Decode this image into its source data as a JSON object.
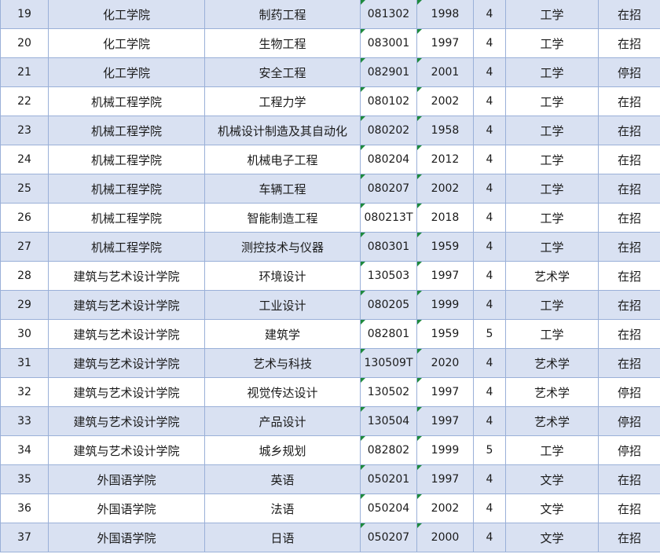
{
  "colors": {
    "band": "#d9e1f2",
    "white": "#ffffff",
    "grid": "#9ab0d8",
    "marker": "#1e8a3e"
  },
  "rows": [
    {
      "no": "19",
      "college": "化工学院",
      "major": "制药工程",
      "code": "081302",
      "year": "1998",
      "duration": "4",
      "degree": "工学",
      "status": "在招"
    },
    {
      "no": "20",
      "college": "化工学院",
      "major": "生物工程",
      "code": "083001",
      "year": "1997",
      "duration": "4",
      "degree": "工学",
      "status": "在招"
    },
    {
      "no": "21",
      "college": "化工学院",
      "major": "安全工程",
      "code": "082901",
      "year": "2001",
      "duration": "4",
      "degree": "工学",
      "status": "停招"
    },
    {
      "no": "22",
      "college": "机械工程学院",
      "major": "工程力学",
      "code": "080102",
      "year": "2002",
      "duration": "4",
      "degree": "工学",
      "status": "在招"
    },
    {
      "no": "23",
      "college": "机械工程学院",
      "major": "机械设计制造及其自动化",
      "code": "080202",
      "year": "1958",
      "duration": "4",
      "degree": "工学",
      "status": "在招"
    },
    {
      "no": "24",
      "college": "机械工程学院",
      "major": "机械电子工程",
      "code": "080204",
      "year": "2012",
      "duration": "4",
      "degree": "工学",
      "status": "在招"
    },
    {
      "no": "25",
      "college": "机械工程学院",
      "major": "车辆工程",
      "code": "080207",
      "year": "2002",
      "duration": "4",
      "degree": "工学",
      "status": "在招"
    },
    {
      "no": "26",
      "college": "机械工程学院",
      "major": "智能制造工程",
      "code": "080213T",
      "year": "2018",
      "duration": "4",
      "degree": "工学",
      "status": "在招"
    },
    {
      "no": "27",
      "college": "机械工程学院",
      "major": "测控技术与仪器",
      "code": "080301",
      "year": "1959",
      "duration": "4",
      "degree": "工学",
      "status": "在招"
    },
    {
      "no": "28",
      "college": "建筑与艺术设计学院",
      "major": "环境设计",
      "code": "130503",
      "year": "1997",
      "duration": "4",
      "degree": "艺术学",
      "status": "在招"
    },
    {
      "no": "29",
      "college": "建筑与艺术设计学院",
      "major": "工业设计",
      "code": "080205",
      "year": "1999",
      "duration": "4",
      "degree": "工学",
      "status": "在招"
    },
    {
      "no": "30",
      "college": "建筑与艺术设计学院",
      "major": "建筑学",
      "code": "082801",
      "year": "1959",
      "duration": "5",
      "degree": "工学",
      "status": "在招"
    },
    {
      "no": "31",
      "college": "建筑与艺术设计学院",
      "major": "艺术与科技",
      "code": "130509T",
      "year": "2020",
      "duration": "4",
      "degree": "艺术学",
      "status": "在招"
    },
    {
      "no": "32",
      "college": "建筑与艺术设计学院",
      "major": "视觉传达设计",
      "code": "130502",
      "year": "1997",
      "duration": "4",
      "degree": "艺术学",
      "status": "停招"
    },
    {
      "no": "33",
      "college": "建筑与艺术设计学院",
      "major": "产品设计",
      "code": "130504",
      "year": "1997",
      "duration": "4",
      "degree": "艺术学",
      "status": "停招"
    },
    {
      "no": "34",
      "college": "建筑与艺术设计学院",
      "major": "城乡规划",
      "code": "082802",
      "year": "1999",
      "duration": "5",
      "degree": "工学",
      "status": "停招"
    },
    {
      "no": "35",
      "college": "外国语学院",
      "major": "英语",
      "code": "050201",
      "year": "1997",
      "duration": "4",
      "degree": "文学",
      "status": "在招"
    },
    {
      "no": "36",
      "college": "外国语学院",
      "major": "法语",
      "code": "050204",
      "year": "2002",
      "duration": "4",
      "degree": "文学",
      "status": "在招"
    },
    {
      "no": "37",
      "college": "外国语学院",
      "major": "日语",
      "code": "050207",
      "year": "2000",
      "duration": "4",
      "degree": "文学",
      "status": "在招"
    }
  ]
}
